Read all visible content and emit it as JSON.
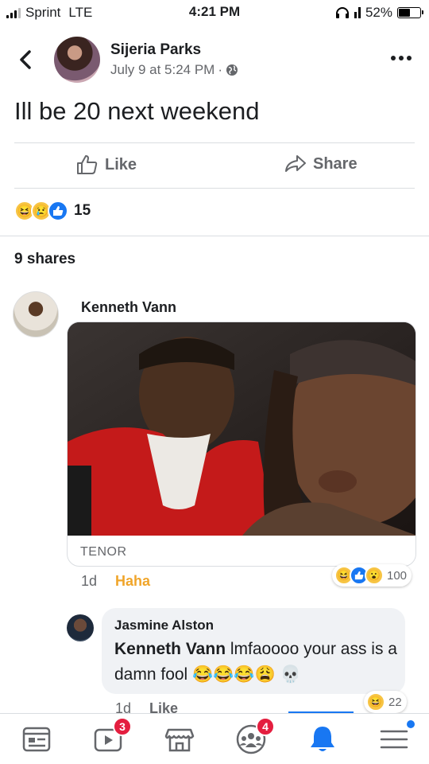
{
  "status": {
    "carrier": "Sprint",
    "network": "LTE",
    "time": "4:21 PM",
    "battery": "52%",
    "battery_level": 0.52
  },
  "post": {
    "author": "Sijeria Parks",
    "date": "July 9 at 5:24 PM",
    "separator": "·",
    "text": "Ill be 20 next weekend",
    "like_label": "Like",
    "share_label": "Share",
    "reaction_icons": [
      "haha-icon",
      "sad-icon",
      "like-icon"
    ],
    "reaction_count": "15",
    "shares": "9 shares"
  },
  "comments": [
    {
      "author": "Kenneth Vann",
      "gif_source": "TENOR",
      "time": "1d",
      "reaction_label": "Haha",
      "reaction_icons": [
        "haha-icon",
        "like-icon",
        "wow-icon"
      ],
      "reaction_count": "100"
    },
    {
      "author": "Jasmine Alston",
      "mention": "Kenneth Vann",
      "text": " lmfaoooo your ass is a damn fool ",
      "emojis": [
        "😂",
        "😂",
        "😂",
        "😩",
        "💀"
      ],
      "time": "1d",
      "like_label": "Like",
      "reaction_icons": [
        "haha-icon"
      ],
      "reaction_count": "22"
    }
  ],
  "tabs": {
    "items": [
      "news-feed-icon",
      "watch-icon",
      "marketplace-icon",
      "groups-icon",
      "notifications-icon",
      "menu-icon"
    ],
    "watch_badge": "3",
    "groups_badge": "4",
    "active": "notifications-icon"
  },
  "colors": {
    "accent": "#1877f2",
    "haha": "#f0a52a",
    "badge": "#e41e3f"
  }
}
